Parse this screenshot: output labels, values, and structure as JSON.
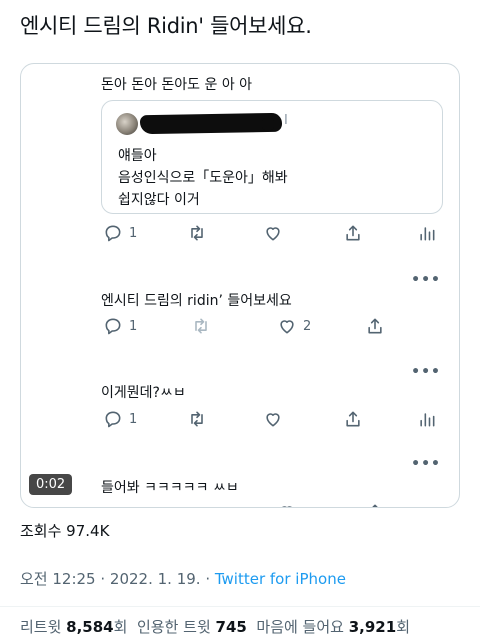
{
  "headline": "엔시티 드림의 Ridin' 들어보세요.",
  "video": {
    "timer": "0:02",
    "top_caption": "돈아 돈아 돈아도 운 아 아",
    "quote": {
      "suffix": "I",
      "lines": [
        "얘들아",
        "음성인식으로「도운아」해봐",
        "쉽지않다 이거"
      ]
    },
    "rows": [
      {
        "reply_count": "1",
        "retweet_count": "",
        "like_count": ""
      },
      {
        "text": "엔시티 드림의 ridin’ 들어보세요",
        "reply_count": "1",
        "retweet_count": "",
        "like_count": "2"
      },
      {
        "text": "이게뭔데?ㅆㅂ",
        "reply_count": "1",
        "retweet_count": "",
        "like_count": ""
      },
      {
        "text": "들어봐 ㅋㅋㅋㅋㅋ ㅆㅂ"
      }
    ],
    "more_label": "•••"
  },
  "views": "조회수 97.4K",
  "meta": {
    "time": "오전 12:25 · 2022. 1. 19. · ",
    "source": "Twitter for iPhone"
  },
  "stats": {
    "retweets_label": "리트윗 ",
    "retweets": "8,584",
    "retweets_unit": "회",
    "quotes_label": "인용한 트윗 ",
    "quotes": "745",
    "likes_label": "마음에 들어요 ",
    "likes": "3,921",
    "likes_unit": "회"
  },
  "colors": {
    "accent": "#1d9bf0",
    "muted": "#536471",
    "border": "#cfd9de"
  },
  "icons": [
    "reply-icon",
    "retweet-icon",
    "like-icon",
    "share-icon",
    "analytics-icon",
    "more-icon"
  ]
}
